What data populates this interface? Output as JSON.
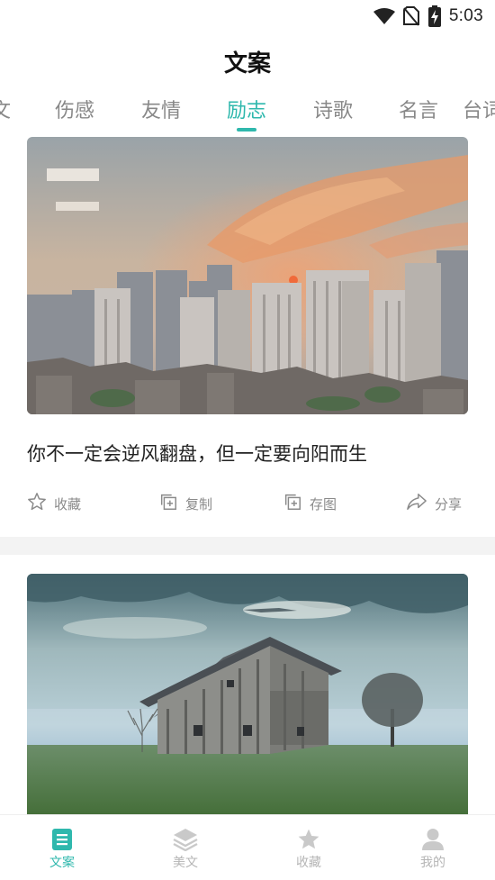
{
  "status_bar": {
    "time": "5:03",
    "icons": [
      "wifi-icon",
      "no-sim-icon",
      "battery-charging-icon"
    ]
  },
  "header": {
    "title": "文案"
  },
  "tabs": [
    {
      "label": "文",
      "active": false
    },
    {
      "label": "伤感",
      "active": false
    },
    {
      "label": "友情",
      "active": false
    },
    {
      "label": "励志",
      "active": true
    },
    {
      "label": "诗歌",
      "active": false
    },
    {
      "label": "名言",
      "active": false
    },
    {
      "label": "台词",
      "active": false
    }
  ],
  "cards": [
    {
      "image": "city-skyline-sunset",
      "text": "你不一定会逆风翻盘，但一定要向阳而生",
      "actions": [
        {
          "icon": "star-outline-icon",
          "label": "收藏"
        },
        {
          "icon": "copy-icon",
          "label": "复制"
        },
        {
          "icon": "save-image-icon",
          "label": "存图"
        },
        {
          "icon": "share-icon",
          "label": "分享"
        }
      ]
    },
    {
      "image": "wooden-barn-fog",
      "text": "",
      "actions": []
    }
  ],
  "bottom_nav": [
    {
      "icon": "document-list-icon",
      "label": "文案",
      "active": true
    },
    {
      "icon": "layers-icon",
      "label": "美文",
      "active": false
    },
    {
      "icon": "star-filled-icon",
      "label": "收藏",
      "active": false
    },
    {
      "icon": "person-icon",
      "label": "我的",
      "active": false
    }
  ],
  "colors": {
    "accent": "#2fb8ad",
    "inactive": "#b5b5b5",
    "text": "#222222",
    "muted": "#8a8a8a"
  }
}
